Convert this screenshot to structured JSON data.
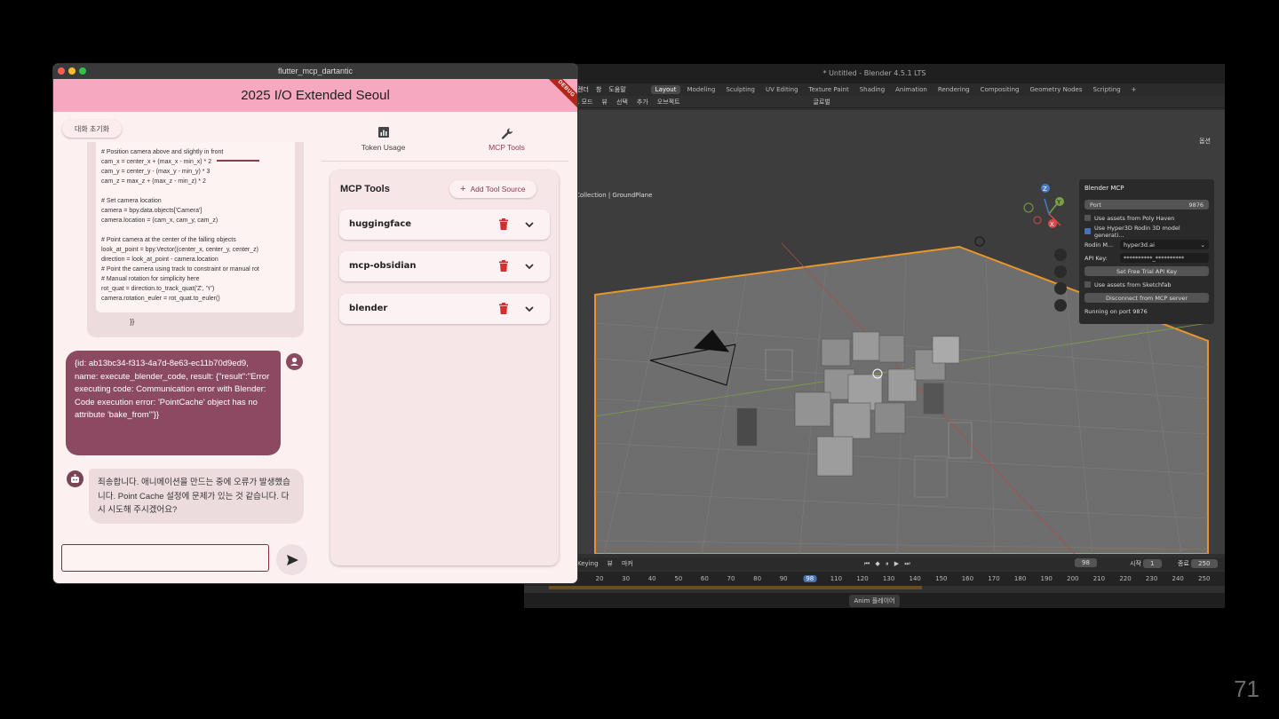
{
  "slide": {
    "page_number": "71"
  },
  "flutter_app": {
    "window_title": "flutter_mcp_dartantic",
    "app_title": "2025 I/O Extended Seoul",
    "debug_banner": "DEBUG",
    "reset_button": "대화 초기화",
    "tabs": [
      {
        "label": "Token Usage",
        "icon": "bar-chart-icon"
      },
      {
        "label": "MCP Tools",
        "icon": "wrench-icon"
      }
    ],
    "active_tab": "MCP Tools",
    "chat": {
      "code_lines": [
        "# Position camera above and slightly in front",
        "cam_x = center_x + (max_x - min_x) * 2",
        "cam_y = center_y - (max_y - min_y) * 3",
        "cam_z = max_z + (max_z - min_z) * 2",
        "",
        "# Set camera location",
        "camera = bpy.data.objects['Camera']",
        "camera.location = (cam_x, cam_y, cam_z)",
        "",
        "# Point camera at the center of the falling objects",
        "look_at_point = bpy.Vector((center_x, center_y, center_z)",
        "direction = look_at_point - camera.location",
        "# Point the camera using track to constraint or manual rot",
        "# Manual rotation for simplicity here",
        "rot_quat = direction.to_track_quat('Z', 'Y')",
        "camera.rotation_euler = rot_quat.to_euler()"
      ],
      "code_close": "}}",
      "user_message": "{id: ab13bc34-f313-4a7d-8e63-ec11b70d9ed9, name: execute_blender_code, result: {\"result\":\"Error executing code: Communication error with Blender: Code execution error: 'PointCache' object has no attribute 'bake_from'\"}}",
      "bot_message": "죄송합니다. 애니메이션을 만드는 중에 오류가 발생했습니다. Point Cache 설정에 문제가 있는 것 같습니다. 다시 시도해 주시겠어요?",
      "input_value": ""
    },
    "mcp_tools": {
      "title": "MCP Tools",
      "add_button": "Add Tool Source",
      "items": [
        "huggingface",
        "mcp-obsidian",
        "blender"
      ]
    },
    "colors": {
      "appbar": "#f5a8bf",
      "accent": "#8b3a4f",
      "user_bubble": "#8b4a62",
      "delete": "#d32f2f"
    }
  },
  "blender": {
    "window_title": "* Untitled - Blender 4.5.1 LTS",
    "menu": [
      "렌더",
      "창",
      "도움말"
    ],
    "workspaces": [
      "Layout",
      "Modeling",
      "Sculpting",
      "UV Editing",
      "Texture Paint",
      "Shading",
      "Animation",
      "Rendering",
      "Compositing",
      "Geometry Nodes",
      "Scripting"
    ],
    "active_workspace": "Layout",
    "header_items": [
      "트 모드",
      "뷰",
      "선택",
      "추가",
      "오브젝트"
    ],
    "transform_orientation": "글로벌",
    "options_label": "옵션",
    "collection_label": "Collection | GroundPlane",
    "panel": {
      "title": "Blender MCP",
      "port_label": "Port",
      "port_value": "9876",
      "poly_haven": "Use assets from Poly Haven",
      "hyper3d": "Use Hyper3D Rodin 3D model generati...",
      "rodin_label": "Rodin M...",
      "rodin_value": "hyper3d.ai",
      "api_label": "API Key:",
      "api_value": "**********_**********",
      "trial_button": "Set Free Trial API Key",
      "sketchfab": "Use assets from Sketchfab",
      "disconnect_button": "Disconnect from MCP server",
      "status": "Running on port 9876"
    },
    "timeline": {
      "keying": "Keying",
      "view": "뷰",
      "marker": "마커",
      "current_frame": "98",
      "start_label": "시작",
      "start": "1",
      "end_label": "종료",
      "end": "250",
      "ticks": [
        "20",
        "30",
        "40",
        "50",
        "60",
        "70",
        "80",
        "90",
        "98",
        "110",
        "120",
        "130",
        "140",
        "150",
        "160",
        "170",
        "180",
        "190",
        "200",
        "210",
        "220",
        "230",
        "240",
        "250"
      ]
    },
    "status_bar": "Anim 플레이어"
  }
}
